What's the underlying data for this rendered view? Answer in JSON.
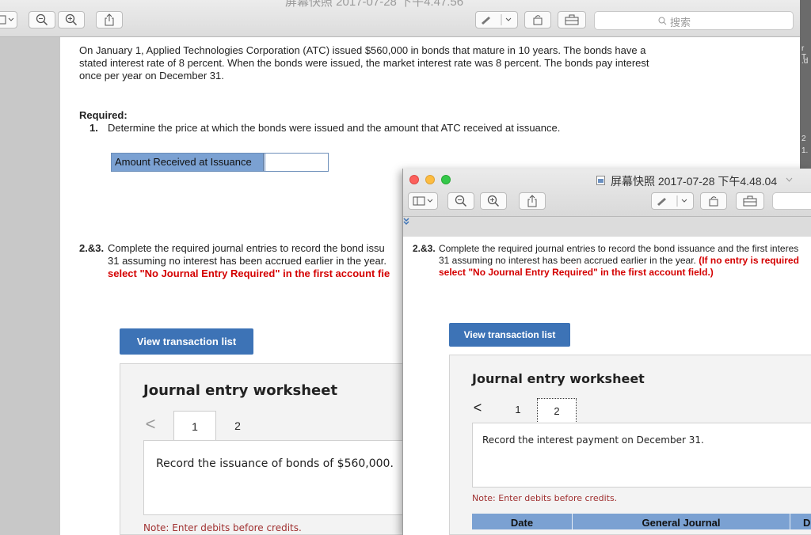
{
  "back_window": {
    "title": "屏幕快照 2017-07-28 下午4.47.56",
    "search_placeholder": "搜索",
    "side_strip": [
      "r T",
      ".d",
      "2",
      "1."
    ],
    "intro": "On January 1, Applied Technologies Corporation (ATC) issued $560,000 in bonds that mature in 10 years. The bonds have a stated interest rate of 8 percent. When the bonds were issued, the market interest rate was 8 percent. The bonds pay interest once per year on December 31.",
    "required_heading": "Required:",
    "req1_num": "1.",
    "req1_text": "Determine the price at which the bonds were issued and the amount that ATC received at issuance.",
    "amount_label": "Amount Received at Issuance",
    "amount_value": "",
    "req23_num": "2.&3.",
    "req23_line1": "Complete the required journal entries to record the bond issu",
    "req23_line2": "31 assuming no interest has been accrued earlier in the year.",
    "req23_red": "select \"No Journal Entry Required\" in the first account fie",
    "view_button": "View transaction list",
    "worksheet_title": "Journal entry worksheet",
    "tab1": "1",
    "tab2": "2",
    "prev_arrow": "<",
    "record_text": "Record the issuance of bonds of $560,000.",
    "note": "Note: Enter debits before credits."
  },
  "front_window": {
    "title": "屏幕快照 2017-07-28 下午4.48.04",
    "req23_num": "2.&3.",
    "req23_line1": "Complete the required journal entries to record the bond issuance and the first interes",
    "req23_line2_black": "31 assuming no interest has been accrued earlier in the year.",
    "req23_line2_red": "(If no entry is required",
    "req23_red": "select \"No Journal Entry Required\" in the first account field.)",
    "view_button": "View transaction list",
    "worksheet_title": "Journal entry worksheet",
    "prev_arrow": "<",
    "tab1": "1",
    "tab2": "2",
    "record_text": "Record the interest payment on December 31.",
    "note": "Note: Enter debits before credits.",
    "columns": [
      "Date",
      "General Journal",
      "D"
    ]
  },
  "colors": {
    "accent": "#3d73b6",
    "table_header": "#7ba1d2",
    "required_red": "#d40000",
    "note_red": "#a03030"
  },
  "icons": [
    "sidebar-icon",
    "zoom-out-icon",
    "zoom-in-icon",
    "share-icon",
    "markup-pen-icon",
    "rotate-icon",
    "toolbox-icon",
    "search-icon",
    "doc-icon",
    "chevron-down-icon"
  ]
}
